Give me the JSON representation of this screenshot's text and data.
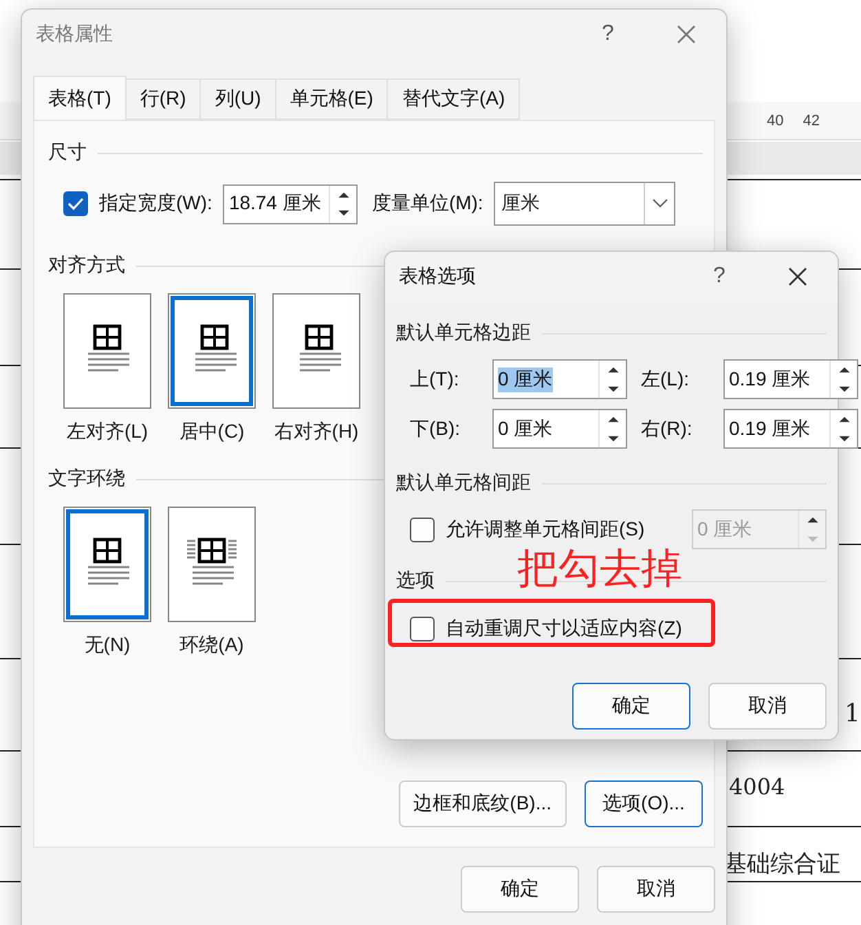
{
  "document": {
    "ruler_numbers": [
      "40",
      "42"
    ],
    "texts": [
      "1",
      "4004",
      "基础综合证"
    ]
  },
  "main_dialog": {
    "title": "表格属性",
    "help": "?",
    "tabs": [
      {
        "label": "表格(T)",
        "selected": true
      },
      {
        "label": "行(R)",
        "selected": false
      },
      {
        "label": "列(U)",
        "selected": false
      },
      {
        "label": "单元格(E)",
        "selected": false
      },
      {
        "label": "替代文字(A)",
        "selected": false
      }
    ],
    "size": {
      "heading": "尺寸",
      "width_checkbox": {
        "label": "指定宽度(W):",
        "checked": true
      },
      "width_value": "18.74 厘米",
      "unit_label": "度量单位(M):",
      "unit_value": "厘米"
    },
    "alignment": {
      "heading": "对齐方式",
      "options": [
        {
          "label": "左对齐(L)",
          "kind": "left",
          "selected": false
        },
        {
          "label": "居中(C)",
          "kind": "center",
          "selected": true
        },
        {
          "label": "右对齐(H)",
          "kind": "right",
          "selected": false
        }
      ]
    },
    "wrapping": {
      "heading": "文字环绕",
      "options": [
        {
          "label": "无(N)",
          "kind": "none",
          "selected": true
        },
        {
          "label": "环绕(A)",
          "kind": "around",
          "selected": false
        }
      ]
    },
    "panel_buttons": [
      {
        "label": "边框和底纹(B)...",
        "default": false
      },
      {
        "label": "选项(O)...",
        "default": true
      }
    ],
    "buttons": [
      {
        "label": "确定",
        "default": false
      },
      {
        "label": "取消",
        "default": false
      }
    ]
  },
  "options_dialog": {
    "title": "表格选项",
    "help": "?",
    "margins": {
      "heading": "默认单元格边距",
      "fields": [
        {
          "label": "上(T):",
          "value": "0 厘米",
          "highlighted": true
        },
        {
          "label": "左(L):",
          "value": "0.19 厘米",
          "highlighted": false
        },
        {
          "label": "下(B):",
          "value": "0 厘米",
          "highlighted": false
        },
        {
          "label": "右(R):",
          "value": "0.19 厘米",
          "highlighted": false
        }
      ]
    },
    "spacing": {
      "heading": "默认单元格间距",
      "checkbox": {
        "label": "允许调整单元格间距(S)",
        "checked": false
      },
      "value": "0 厘米",
      "disabled": true
    },
    "options": {
      "heading": "选项",
      "checkbox": {
        "label": "自动重调尺寸以适应内容(Z)",
        "checked": false
      }
    },
    "buttons": [
      {
        "label": "确定",
        "default": true
      },
      {
        "label": "取消",
        "default": false
      }
    ]
  },
  "annotation": {
    "text": "把勾去掉"
  }
}
